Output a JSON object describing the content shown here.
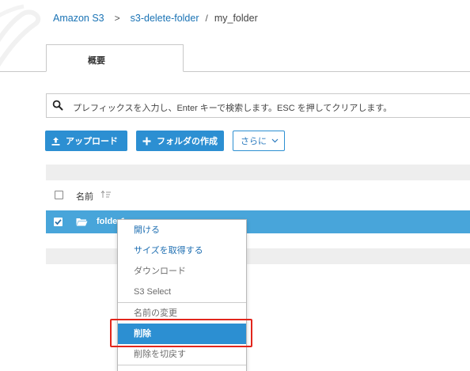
{
  "breadcrumb": {
    "items": [
      "Amazon S3",
      "s3-delete-folder",
      "my_folder"
    ],
    "separators": [
      ">",
      "/"
    ]
  },
  "tabs": [
    {
      "label": "概要"
    }
  ],
  "search": {
    "placeholder": "プレフィックスを入力し、Enter キーで検索します。ESC を押してクリアします。"
  },
  "toolbar": {
    "upload_label": "アップロード",
    "create_folder_label": "フォルダの作成",
    "more_label": "さらに"
  },
  "table": {
    "column_name": "名前",
    "rows": [
      {
        "name": "folder1",
        "selected": true
      }
    ]
  },
  "context_menu": {
    "items": [
      {
        "label": "開ける",
        "state": "enabled"
      },
      {
        "label": "サイズを取得する",
        "state": "enabled"
      },
      {
        "label": "ダウンロード",
        "state": "disabled"
      },
      {
        "label": "S3 Select",
        "state": "disabled"
      },
      {
        "label": "名前の変更",
        "state": "disabled"
      },
      {
        "label": "削除",
        "state": "active"
      },
      {
        "label": "削除を切戻す",
        "state": "disabled"
      }
    ]
  },
  "colors": {
    "accent": "#2c8fd2",
    "selected_row": "#48a5da",
    "link": "#1a73b5",
    "highlight_box": "#e2261c"
  }
}
